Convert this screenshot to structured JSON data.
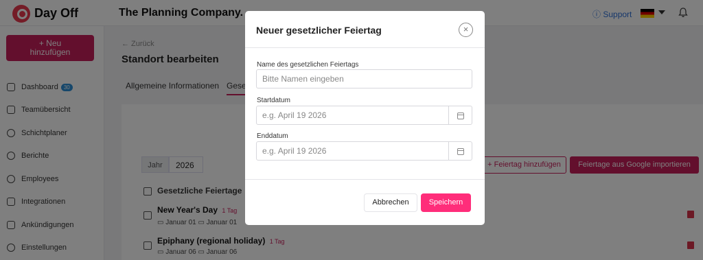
{
  "app": {
    "logo_text": "Day Off",
    "company": "The Planning Company."
  },
  "topbar": {
    "support_label": "Support"
  },
  "sidebar": {
    "new_button": {
      "line1": "+ Neu",
      "line2": "hinzufügen"
    },
    "items": [
      {
        "label": "Dashboard",
        "badge": "30"
      },
      {
        "label": "Teamübersicht"
      },
      {
        "label": "Schichtplaner"
      },
      {
        "label": "Berichte"
      },
      {
        "label": "Employees"
      },
      {
        "label": "Integrationen"
      },
      {
        "label": "Ankündigungen"
      },
      {
        "label": "Einstellungen"
      }
    ]
  },
  "page": {
    "back_label": "← Zurück",
    "title": "Standort bearbeiten",
    "tabs": [
      "Allgemeine Informationen",
      "Gese"
    ]
  },
  "holidays": {
    "year_label": "Jahr",
    "year_value": "2026",
    "add_button": "+ Feiertag hinzufügen",
    "import_button": "Feiertage aus Google importieren",
    "list_header": "Gesetzliche Feiertage",
    "rows": [
      {
        "name": "New Year's Day",
        "days": "1 Tag",
        "start": "Januar 01",
        "end": "Januar 01"
      },
      {
        "name": "Epiphany (regional holiday)",
        "days": "1 Tag",
        "start": "Januar 06",
        "end": "Januar 06"
      }
    ]
  },
  "modal": {
    "title": "Neuer gesetzlicher Feiertag",
    "close_glyph": "×",
    "name_label": "Name des gesetzlichen Feiertags",
    "name_placeholder": "Bitte Namen eingeben",
    "start_label": "Startdatum",
    "start_placeholder": "e.g. April 19 2026",
    "end_label": "Enddatum",
    "end_placeholder": "e.g. April 19 2026",
    "cancel_label": "Abbrechen",
    "save_label": "Speichern"
  },
  "colors": {
    "brand": "#c71f5b",
    "save": "#ff2d7a",
    "link": "#2c6fd6"
  }
}
